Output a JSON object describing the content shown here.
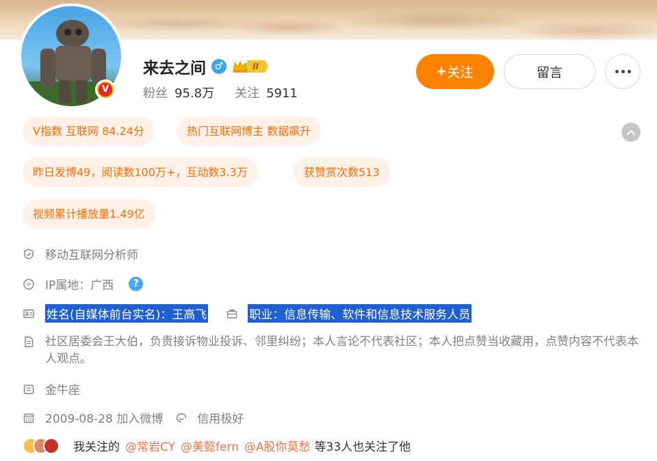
{
  "profile": {
    "name": "来去之间",
    "gender_symbol": "♂",
    "level_badge": "II",
    "verified_badge": "V",
    "followers_label": "粉丝",
    "followers_count": "95.8万",
    "following_label": "关注",
    "following_count": "5911"
  },
  "actions": {
    "follow_plus": "+",
    "follow_label": "关注",
    "message_label": "留言"
  },
  "tags": [
    "V指数 互联网 84.24分",
    "热门互联网博主 数据飙升",
    "昨日发博49，阅读数100万+，互动数3.3万",
    "获赞赏次数513",
    "视频累计播放量1.49亿"
  ],
  "info": {
    "certification": "移动互联网分析师",
    "ip_location": "IP属地：广西",
    "help_symbol": "?",
    "real_name": "姓名(自媒体前台实名)：王高飞",
    "occupation": "职业：信息传输、软件和信息技术服务人员",
    "bio": "社区居委会王大伯，负责接诉物业投诉、邻里纠纷；本人言论不代表社区；本人把点赞当收藏用，点赞内容不代表本人观点。",
    "constellation": "金牛座",
    "join_date": "2009-08-28 加入微博",
    "credit": "信用极好"
  },
  "mutual": {
    "lead": "我关注的",
    "users": [
      "@常岩CY",
      "@美懿fern",
      "@A股你莫愁"
    ],
    "tail": "等33人也关注了他"
  },
  "colors": {
    "accent": "#ff8200",
    "tag_bg": "#fff1e8",
    "tag_text": "#ff6b00",
    "link": "#eb7350",
    "selection": "#1f5fd0"
  }
}
